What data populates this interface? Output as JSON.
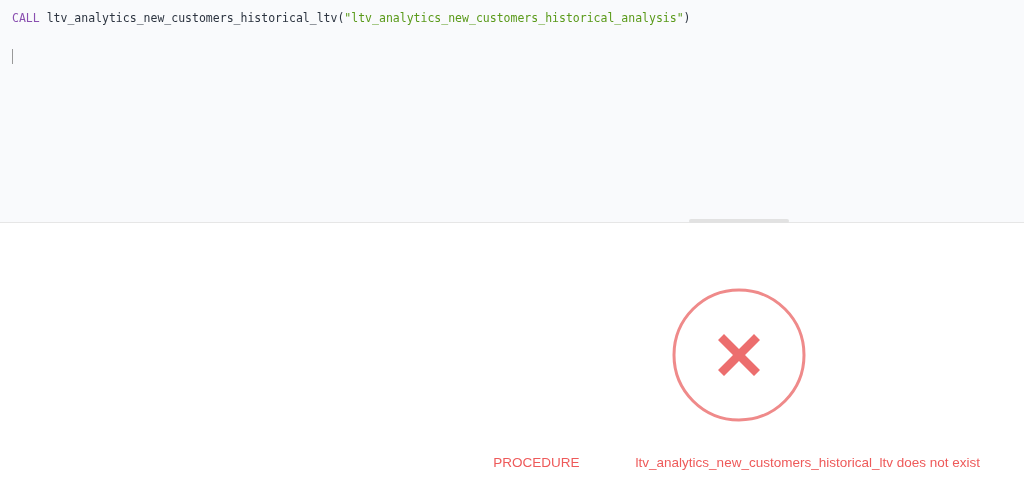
{
  "editor": {
    "tokens": [
      {
        "kind": "keyword",
        "text": "CALL"
      },
      {
        "kind": "plain",
        "text": " ltv_analytics_new_customers_historical_ltv("
      },
      {
        "kind": "string",
        "text": "\"ltv_analytics_new_customers_historical_analysis\""
      },
      {
        "kind": "plain",
        "text": ")"
      }
    ]
  },
  "error": {
    "parts": [
      "PROCEDURE",
      "ltv_analytics_new_customers_historical_ltv does not exist"
    ]
  }
}
